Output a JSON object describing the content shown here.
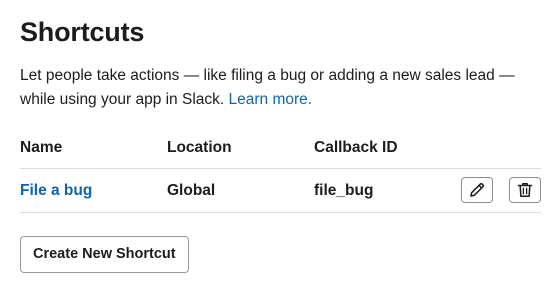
{
  "page": {
    "title": "Shortcuts",
    "description": "Let people take actions — like filing a bug or adding a new sales lead — while using your app in Slack.",
    "learn_more": "Learn more."
  },
  "table": {
    "columns": [
      "Name",
      "Location",
      "Callback ID"
    ],
    "rows": [
      {
        "name": "File a bug",
        "location": "Global",
        "callback_id": "file_bug",
        "actions": [
          "pencil-icon",
          "trash-icon"
        ]
      }
    ]
  },
  "create_button": "Create New Shortcut",
  "colors": {
    "text": "#1d1c1d",
    "link": "#1264a3",
    "divider": "#dddddd",
    "button_border": "#8d8d8d"
  }
}
